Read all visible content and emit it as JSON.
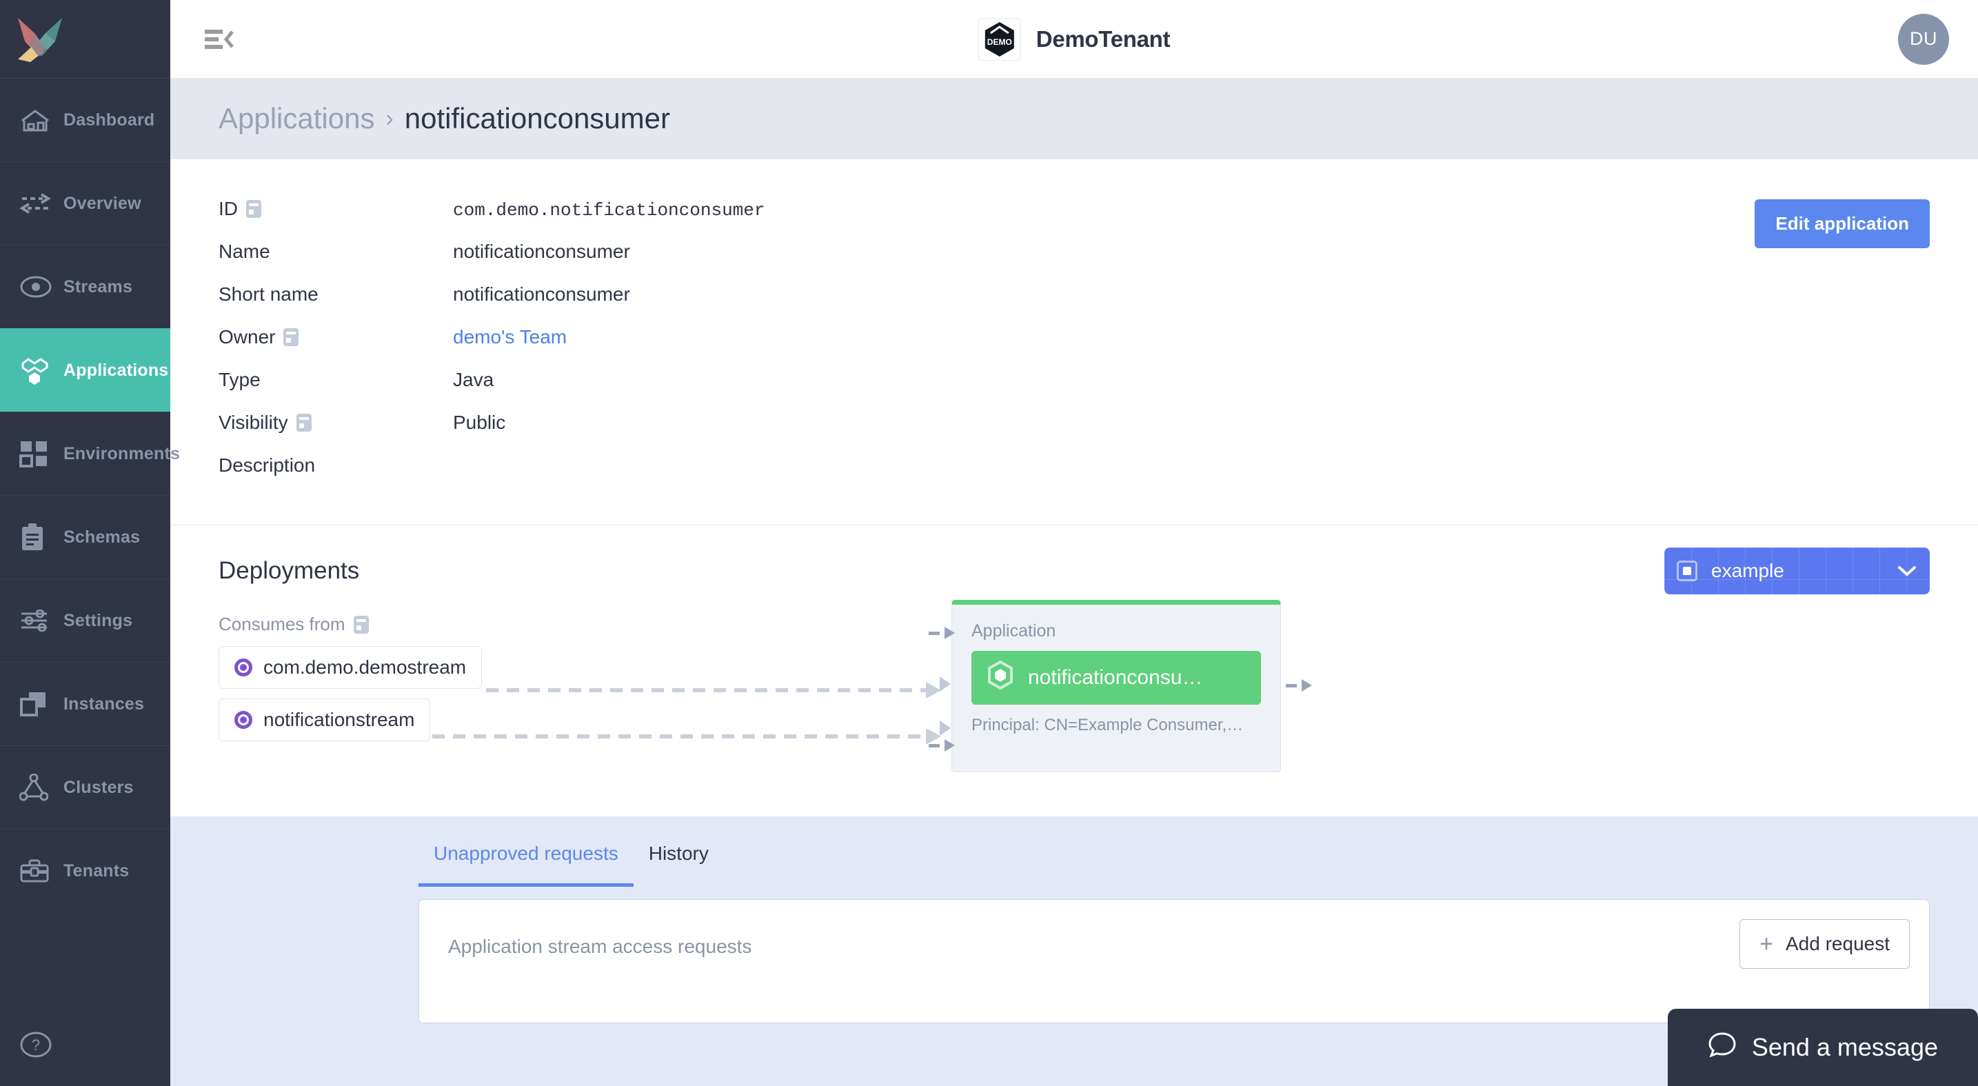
{
  "sidebar": {
    "logo_name": "axual-logo",
    "items": [
      {
        "label": "Dashboard",
        "icon": "home-icon",
        "active": false
      },
      {
        "label": "Overview",
        "icon": "exchange-icon",
        "active": false
      },
      {
        "label": "Streams",
        "icon": "stream-icon",
        "active": false
      },
      {
        "label": "Applications",
        "icon": "applications-icon",
        "active": true
      },
      {
        "label": "Environments",
        "icon": "grid-icon",
        "active": false
      },
      {
        "label": "Schemas",
        "icon": "clipboard-icon",
        "active": false
      },
      {
        "label": "Settings",
        "icon": "sliders-icon",
        "active": false
      },
      {
        "label": "Instances",
        "icon": "windows-icon",
        "active": false
      },
      {
        "label": "Clusters",
        "icon": "cluster-icon",
        "active": false
      },
      {
        "label": "Tenants",
        "icon": "toolbox-icon",
        "active": false
      }
    ],
    "help_icon": "question-circle-icon"
  },
  "topbar": {
    "menu_icon": "collapse-sidebar-icon",
    "tenant_logo_text": "DEMO",
    "tenant_name": "DemoTenant",
    "avatar_initials": "DU"
  },
  "breadcrumb": {
    "parent": "Applications",
    "separator": "›",
    "current": "notificationconsumer"
  },
  "details": {
    "edit_button": "Edit application",
    "rows": [
      {
        "label": "ID",
        "value": "com.demo.notificationconsumer",
        "mono": true,
        "info": true,
        "link": false
      },
      {
        "label": "Name",
        "value": "notificationconsumer",
        "mono": false,
        "info": false,
        "link": false
      },
      {
        "label": "Short name",
        "value": "notificationconsumer",
        "mono": false,
        "info": false,
        "link": false
      },
      {
        "label": "Owner",
        "value": "demo's Team",
        "mono": false,
        "info": true,
        "link": true
      },
      {
        "label": "Type",
        "value": "Java",
        "mono": false,
        "info": false,
        "link": false
      },
      {
        "label": "Visibility",
        "value": "Public",
        "mono": false,
        "info": true,
        "link": false
      },
      {
        "label": "Description",
        "value": "",
        "mono": false,
        "info": false,
        "link": false
      }
    ]
  },
  "deployments": {
    "title": "Deployments",
    "environment": {
      "icon": "environment-icon",
      "value": "example",
      "chevron": "⌄"
    },
    "graph": {
      "consumes_from_label": "Consumes from",
      "streams": [
        {
          "name": "com.demo.demostream"
        },
        {
          "name": "notificationstream"
        }
      ],
      "node": {
        "kind": "Application",
        "name": "notificationconsu…",
        "icon": "hexagon-app-icon",
        "principal": "Principal: CN=Example Consumer,…"
      }
    }
  },
  "requests": {
    "tabs": [
      {
        "label": "Unapproved requests",
        "active": true
      },
      {
        "label": "History",
        "active": false
      }
    ],
    "card_placeholder": "Application stream access requests",
    "add_button": "Add request",
    "add_icon": "plus-icon"
  },
  "chat": {
    "icon": "chat-bubble-icon",
    "label": "Send a message"
  },
  "colors": {
    "sidebar_bg": "#2f3545",
    "sidebar_active": "#48bfae",
    "accent_blue": "#5b87ef",
    "env_blue": "#5b78ef",
    "node_green": "#5fd07d",
    "stream_purple": "#7e52cf",
    "crumb_bg": "#e4e7ee",
    "requests_bg": "#e2e8f5"
  }
}
